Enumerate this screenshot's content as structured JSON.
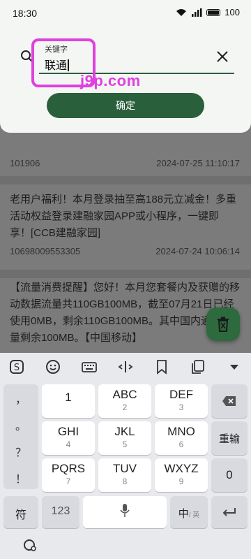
{
  "status_bar": {
    "time": "18:30",
    "battery": "100"
  },
  "search": {
    "label": "关键字",
    "value": "联通"
  },
  "watermark": "j9p.com",
  "confirm_label": "确定",
  "messages": [
    {
      "text": "",
      "sender": "101906",
      "date": "2024-07-25 11:10:17"
    },
    {
      "text": "老用户福利！本月登录抽至高188元立减金！多重活动权益登录建融家园APP或小程序，一键即享！[CCB建融家园]",
      "sender": "10698009553305",
      "date": "2024-07-24 10:06:14"
    },
    {
      "text": "【流量消费提醒】您好！本月您套餐内及获赠的移动数据流量共110GB100MB，截至07月21日已经使用0MB，剩余110GB100MB。其中国内通用流量剩余100MB。【中国移动】"
    }
  ],
  "keyboard": {
    "punct": [
      "，",
      "。",
      "？",
      "！"
    ],
    "rows": [
      [
        {
          "main": "1",
          "sub": ""
        },
        {
          "main": "ABC",
          "sub": "2"
        },
        {
          "main": "DEF",
          "sub": "3"
        }
      ],
      [
        {
          "main": "GHI",
          "sub": "4"
        },
        {
          "main": "JKL",
          "sub": "5"
        },
        {
          "main": "MNO",
          "sub": "6"
        }
      ],
      [
        {
          "main": "PQRS",
          "sub": "7"
        },
        {
          "main": "TUV",
          "sub": "8"
        },
        {
          "main": "WXYZ",
          "sub": "9"
        }
      ]
    ],
    "reenter_label": "重输",
    "zero_label": "0",
    "symbol_label": "符",
    "num_label": "123",
    "lang_main": "中",
    "lang_sub": "/ 英"
  }
}
